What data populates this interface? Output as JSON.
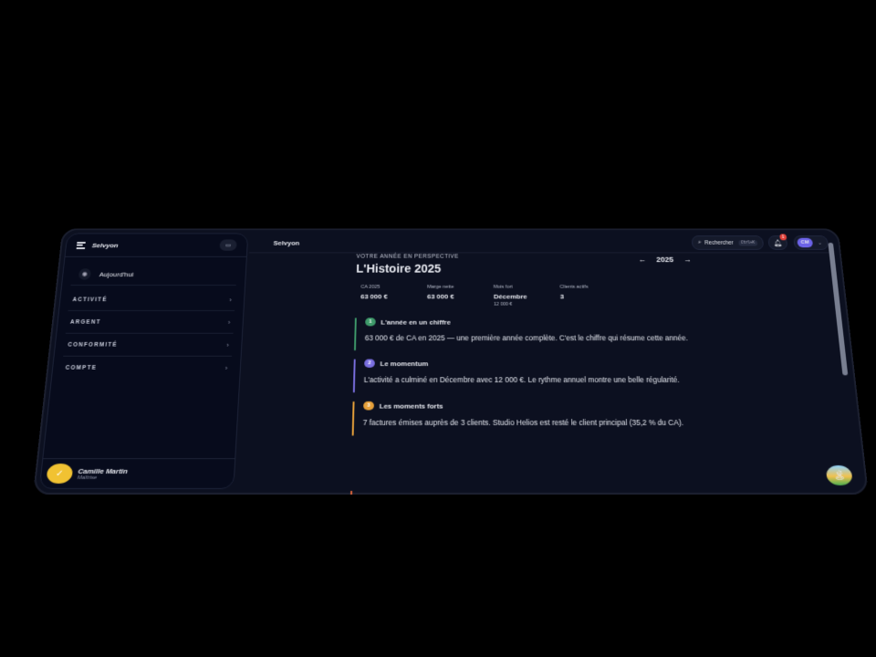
{
  "app": {
    "brand": "Selvyon",
    "topbar_title": "Selvyon"
  },
  "sidebar": {
    "today_label": "Aujourd'hui",
    "sections": [
      {
        "label": "ACTIVITÉ"
      },
      {
        "label": "ARGENT"
      },
      {
        "label": "CONFORMITÉ"
      },
      {
        "label": "COMPTE"
      }
    ],
    "user": {
      "name": "Camille Martin",
      "role": "Maîtrise"
    }
  },
  "topbar": {
    "search_label": "Rechercher",
    "search_shortcut": "Ctrl+K",
    "notification_count": "1",
    "user_initials": "CM"
  },
  "page": {
    "kicker": "VOTRE ANNÉE EN PERSPECTIVE",
    "title": "L'Histoire 2025",
    "year": "2025",
    "prev_arrow": "←",
    "next_arrow": "→"
  },
  "kpis": [
    {
      "label": "CA 2025",
      "value": "63 000 €",
      "sub": ""
    },
    {
      "label": "Marge nette",
      "value": "63 000 €",
      "sub": ""
    },
    {
      "label": "Mois fort",
      "value": "Décembre",
      "sub": "12 000 €"
    },
    {
      "label": "Clients actifs",
      "value": "3",
      "sub": ""
    }
  ],
  "stories": [
    {
      "num": "1",
      "title": "L'année en un chiffre",
      "text": "63 000 € de CA en 2025 — une première année complète. C'est le chiffre qui résume cette année.",
      "color": "#3f9b6b"
    },
    {
      "num": "2",
      "title": "Le momentum",
      "text": "L'activité a culminé en Décembre avec 12 000 €. Le rythme annuel montre une belle régularité.",
      "color": "#7a6fe0"
    },
    {
      "num": "3",
      "title": "Les moments forts",
      "text": "7 factures émises auprès de 3 clients. Studio Helios est resté le client principal (35,2 % du CA).",
      "color": "#e6a03a"
    }
  ]
}
